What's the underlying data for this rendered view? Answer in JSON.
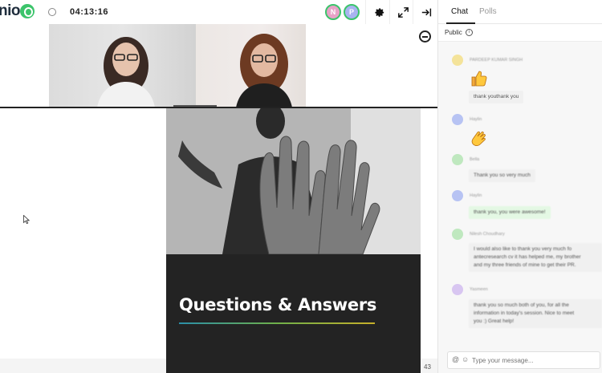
{
  "header": {
    "logo_text": "nio",
    "timer": "04:13:16",
    "avatars": [
      {
        "initial": "N",
        "color": "#e8a2c7"
      },
      {
        "initial": "P",
        "color": "#a9b3f0"
      }
    ],
    "icons": [
      "gear-icon",
      "expand-icon",
      "exit-icon"
    ]
  },
  "slide": {
    "title": "Questions & Answers",
    "page_number": "43"
  },
  "chat": {
    "tabs": [
      {
        "label": "Chat",
        "active": true
      },
      {
        "label": "Polls",
        "active": false
      }
    ],
    "scope_label": "Public",
    "messages": [
      {
        "name": "PARDEEP KUMAR SINGH",
        "avatar_color": "#f4e39a",
        "emoji": "thumbs-up-icon",
        "text": "thank youthank you"
      },
      {
        "name": "Haylin",
        "avatar_color": "#b7c3f3",
        "emoji": "clapping-hands-icon",
        "text": ""
      },
      {
        "name": "Bella",
        "avatar_color": "#bfe8bf",
        "text": "Thank you so very much"
      },
      {
        "name": "Haylin",
        "avatar_color": "#b7c3f3",
        "text": "thank you, you were awesome!"
      },
      {
        "name": "Nilesh Choudhary",
        "avatar_color": "#bfe8bf",
        "text_lines": [
          "I would also like to thank you very much fo",
          "antecresearch cv it has helped me, my brother",
          "and my three friends of mine to get their PR."
        ]
      },
      {
        "name": "Yasmeen",
        "avatar_color": "#d8c6f1",
        "text_lines": [
          "thank you so much both of you, for all the",
          "information in today's session. Nice to meet",
          "you :) Great help!"
        ]
      }
    ],
    "input_placeholder": "Type your message..."
  }
}
